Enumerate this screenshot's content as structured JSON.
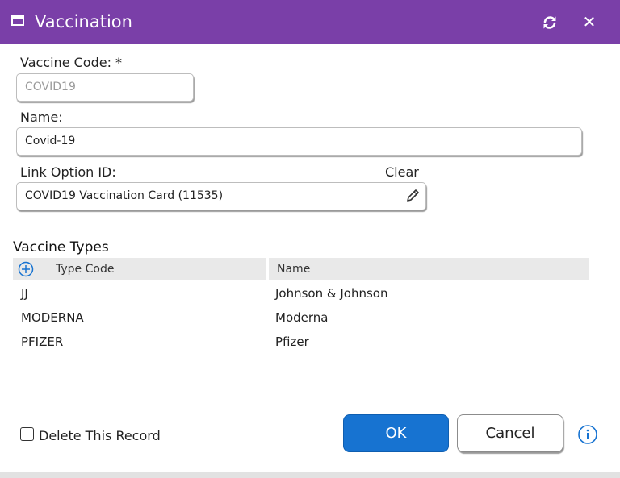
{
  "window": {
    "title": "Vaccination",
    "title_bar_color": "#7a3fa8",
    "title_icon": "window-icon",
    "refresh_icon": "refresh-icon",
    "close_icon": "close-icon",
    "close_glyph": "✕"
  },
  "form": {
    "vaccine_code": {
      "label": "Vaccine Code: *",
      "value": "COVID19",
      "disabled": true
    },
    "name": {
      "label": "Name:",
      "value": "Covid-19"
    },
    "link_option": {
      "label": "Link Option ID:",
      "clear_label": "Clear",
      "value": "COVID19 Vaccination Card (11535)",
      "edit_icon": "pencil-icon"
    }
  },
  "vaccine_types": {
    "title": "Vaccine Types",
    "add_icon": "add-circle-icon",
    "columns": [
      "Type Code",
      "Name"
    ],
    "rows": [
      {
        "code": "JJ",
        "name": "Johnson & Johnson"
      },
      {
        "code": "MODERNA",
        "name": "Moderna"
      },
      {
        "code": "PFIZER",
        "name": "Pfizer"
      }
    ]
  },
  "footer": {
    "delete_label": "Delete This Record",
    "delete_checked": false,
    "ok_label": "OK",
    "cancel_label": "Cancel",
    "info_icon": "info-icon",
    "ok_color": "#1773d1"
  }
}
